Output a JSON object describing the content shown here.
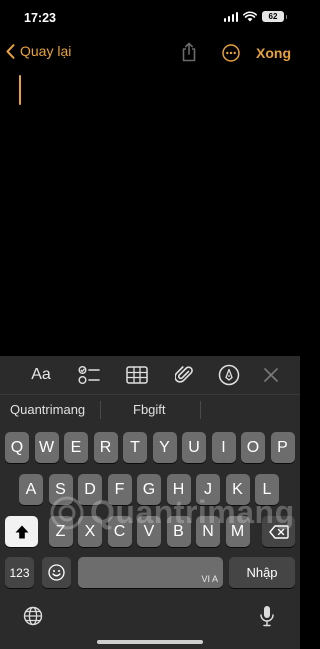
{
  "status": {
    "time": "17:23",
    "battery": "62"
  },
  "nav": {
    "back_label": "Quay lại",
    "done_label": "Xong"
  },
  "toolbar": {
    "format_label": "Aa"
  },
  "suggestions": [
    "Quantrimang",
    "Fbgift",
    ""
  ],
  "keys": {
    "row1": [
      "Q",
      "W",
      "E",
      "R",
      "T",
      "Y",
      "U",
      "I",
      "O",
      "P"
    ],
    "row2": [
      "A",
      "S",
      "D",
      "F",
      "G",
      "H",
      "J",
      "K",
      "L"
    ],
    "row3": [
      "Z",
      "X",
      "C",
      "V",
      "B",
      "N",
      "M"
    ],
    "numbers": "123",
    "space_lang": "VI A",
    "return": "Nhập"
  },
  "watermark": "Quantrimang",
  "colors": {
    "accent": "#e8a23a",
    "keyboard_bg": "#2b2b2b",
    "key": "#6d6d6d",
    "key_dark": "#454545"
  }
}
